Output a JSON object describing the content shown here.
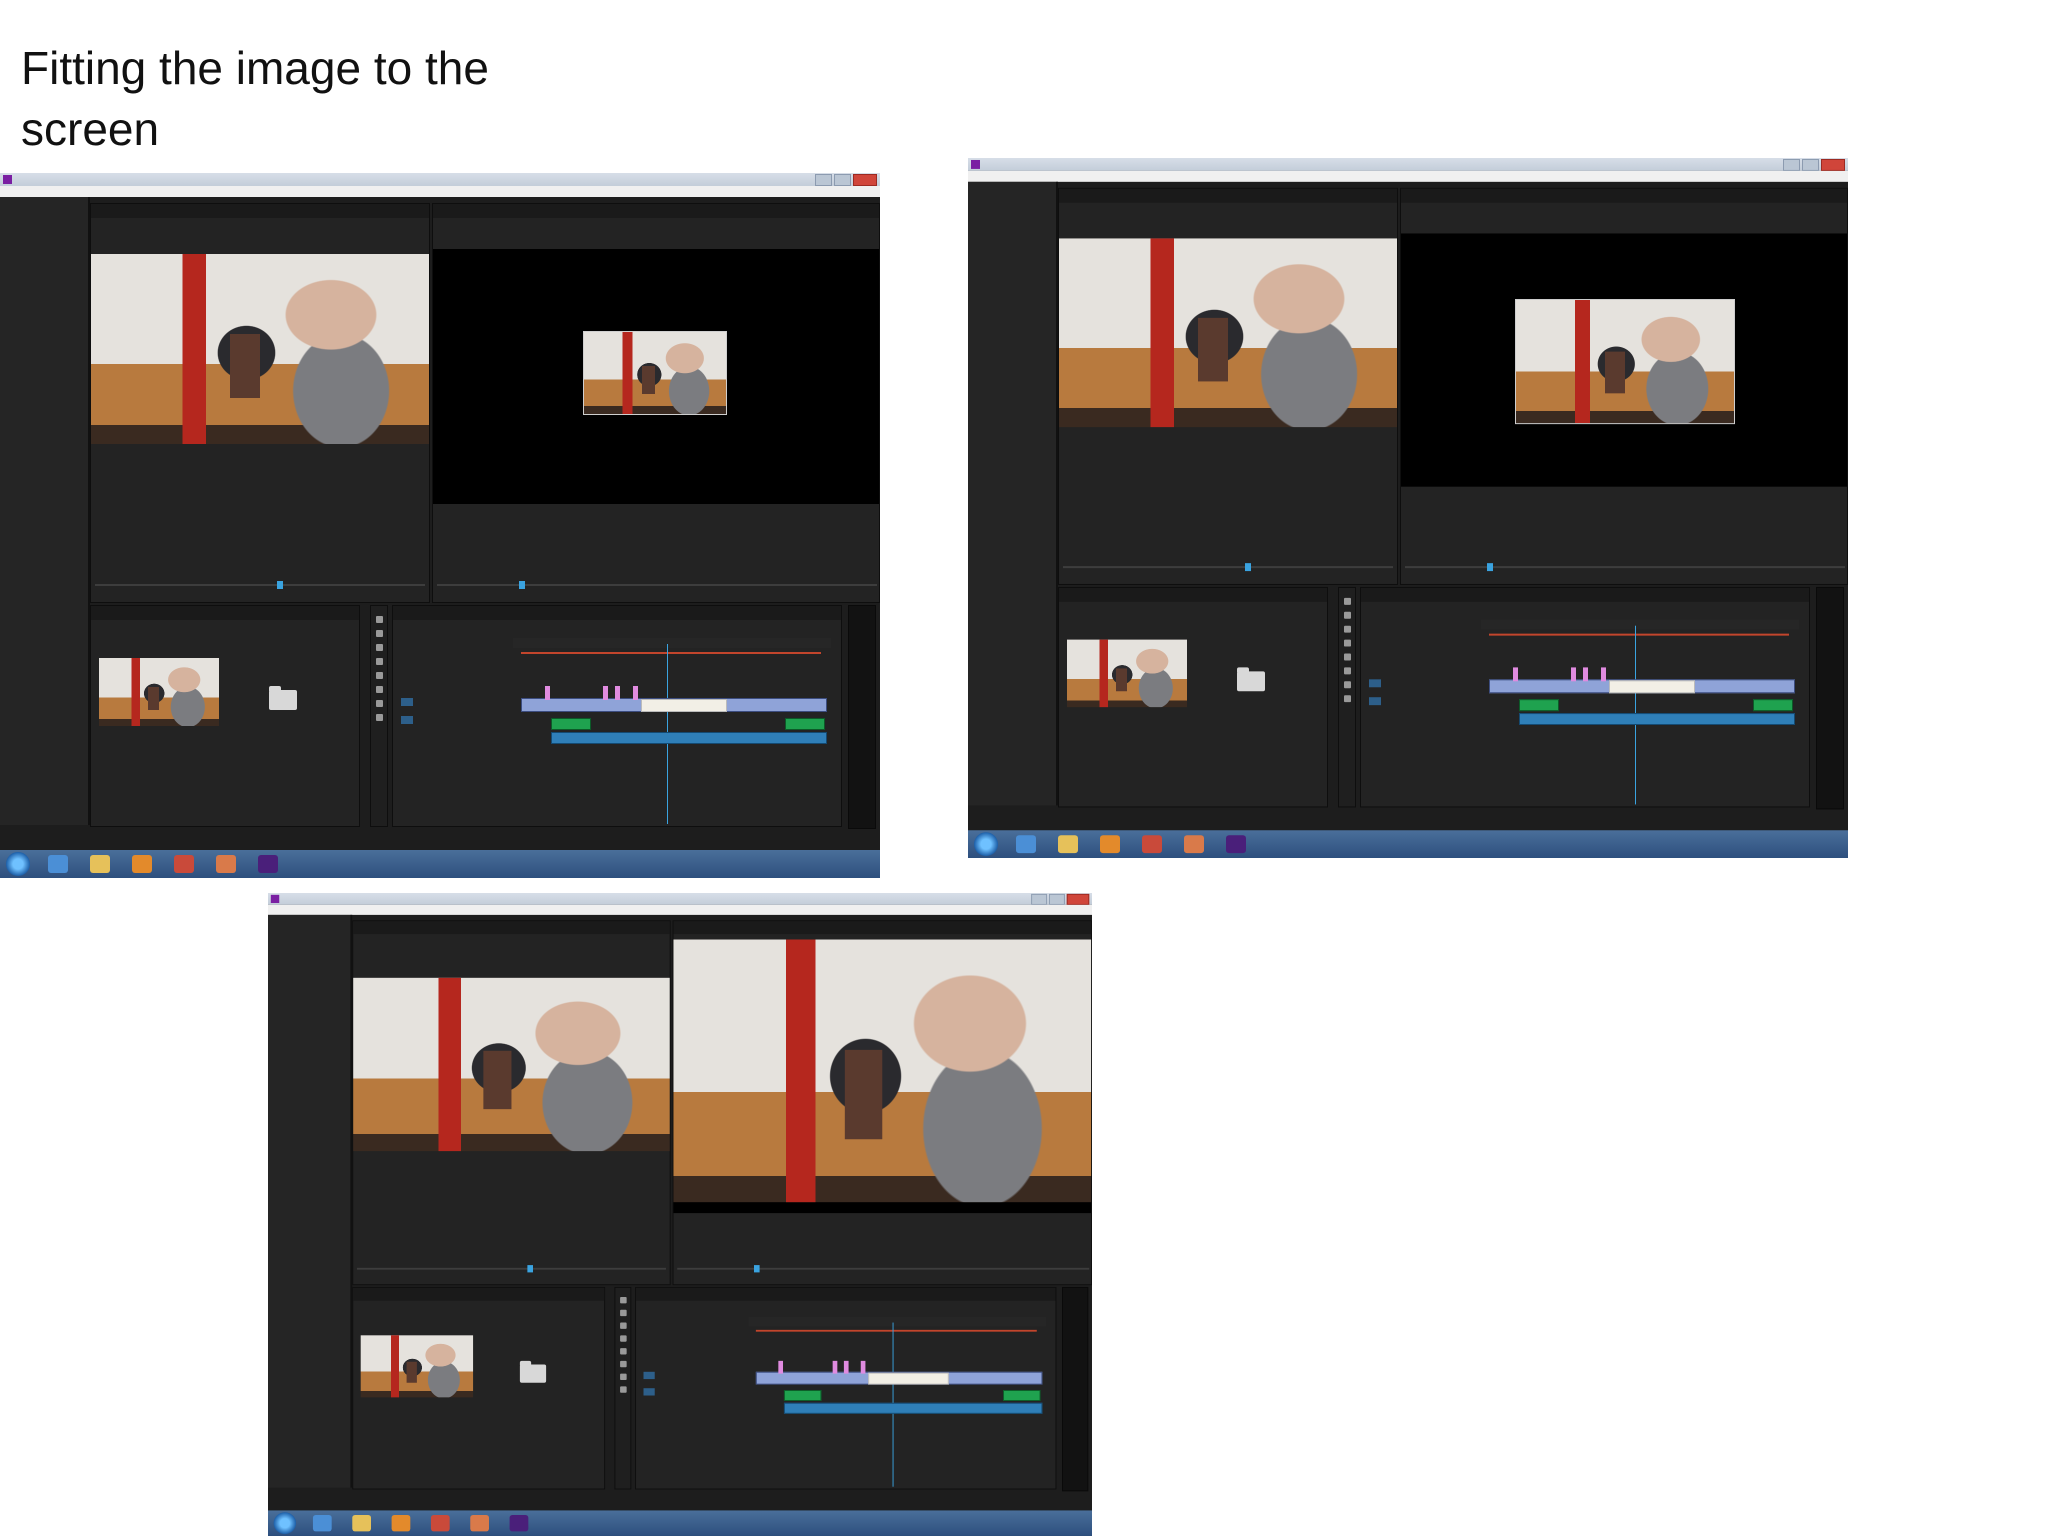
{
  "slide": {
    "title": "Fitting the image to the screen"
  },
  "screenshots": [
    {
      "id": "shot-1",
      "program_fit": "small"
    },
    {
      "id": "shot-2",
      "program_fit": "medium"
    },
    {
      "id": "shot-3",
      "program_fit": "full"
    }
  ]
}
